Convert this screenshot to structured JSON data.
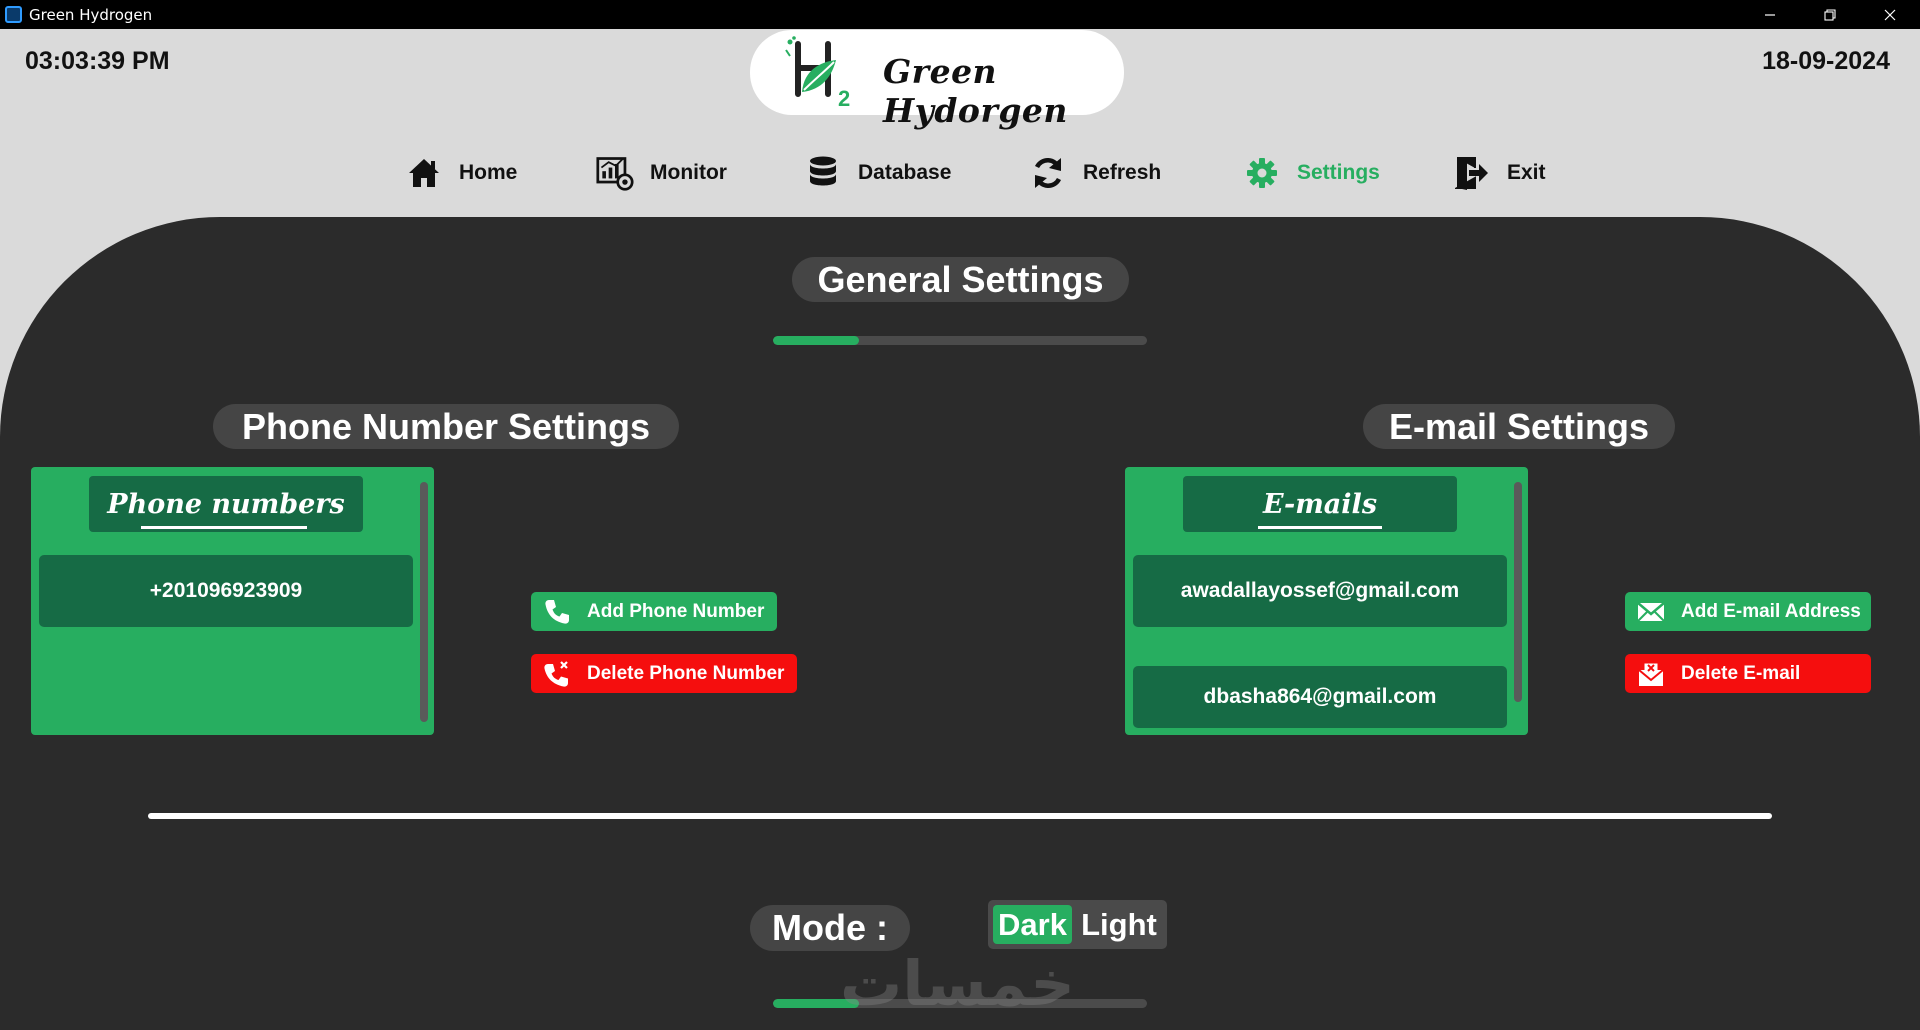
{
  "window": {
    "title": "Green Hydrogen",
    "controls": {
      "minimize": "minimize-icon",
      "restore": "restore-icon",
      "close": "close-icon"
    }
  },
  "header": {
    "time": "03:03:39 PM",
    "date": "18-09-2024",
    "logo": {
      "mark": "H",
      "subscript": "2",
      "text": "Green Hydorgen"
    }
  },
  "nav": {
    "items": [
      {
        "label": "Home",
        "icon": "home-icon"
      },
      {
        "label": "Monitor",
        "icon": "monitor-icon"
      },
      {
        "label": "Database",
        "icon": "database-icon"
      },
      {
        "label": "Refresh",
        "icon": "refresh-icon"
      },
      {
        "label": "Settings",
        "icon": "gear-icon",
        "active": true
      },
      {
        "label": "Exit",
        "icon": "exit-icon"
      }
    ]
  },
  "settings": {
    "title": "General Settings",
    "progress": 0.23,
    "phone": {
      "title": "Phone Number Settings",
      "list_header": "Phone numbers",
      "entries": [
        "+201096923909"
      ],
      "add_label": "Add Phone Number",
      "delete_label": "Delete Phone Number"
    },
    "email": {
      "title": "E-mail Settings",
      "list_header": "E-mails",
      "entries": [
        "awadallayossef@gmail.com",
        "dbasha864@gmail.com"
      ],
      "add_label": "Add E-mail Address",
      "delete_label": "Delete E-mail"
    },
    "mode": {
      "label": "Mode :",
      "options": [
        "Dark",
        "Light"
      ],
      "selected": "Dark",
      "progress": 0.23
    }
  },
  "watermark": "خمسات",
  "colors": {
    "accent_green": "#27ae60",
    "dark_green": "#166b45",
    "danger_red": "#f50e0e",
    "panel_bg": "#2b2b2b",
    "header_bg": "#dadada"
  }
}
